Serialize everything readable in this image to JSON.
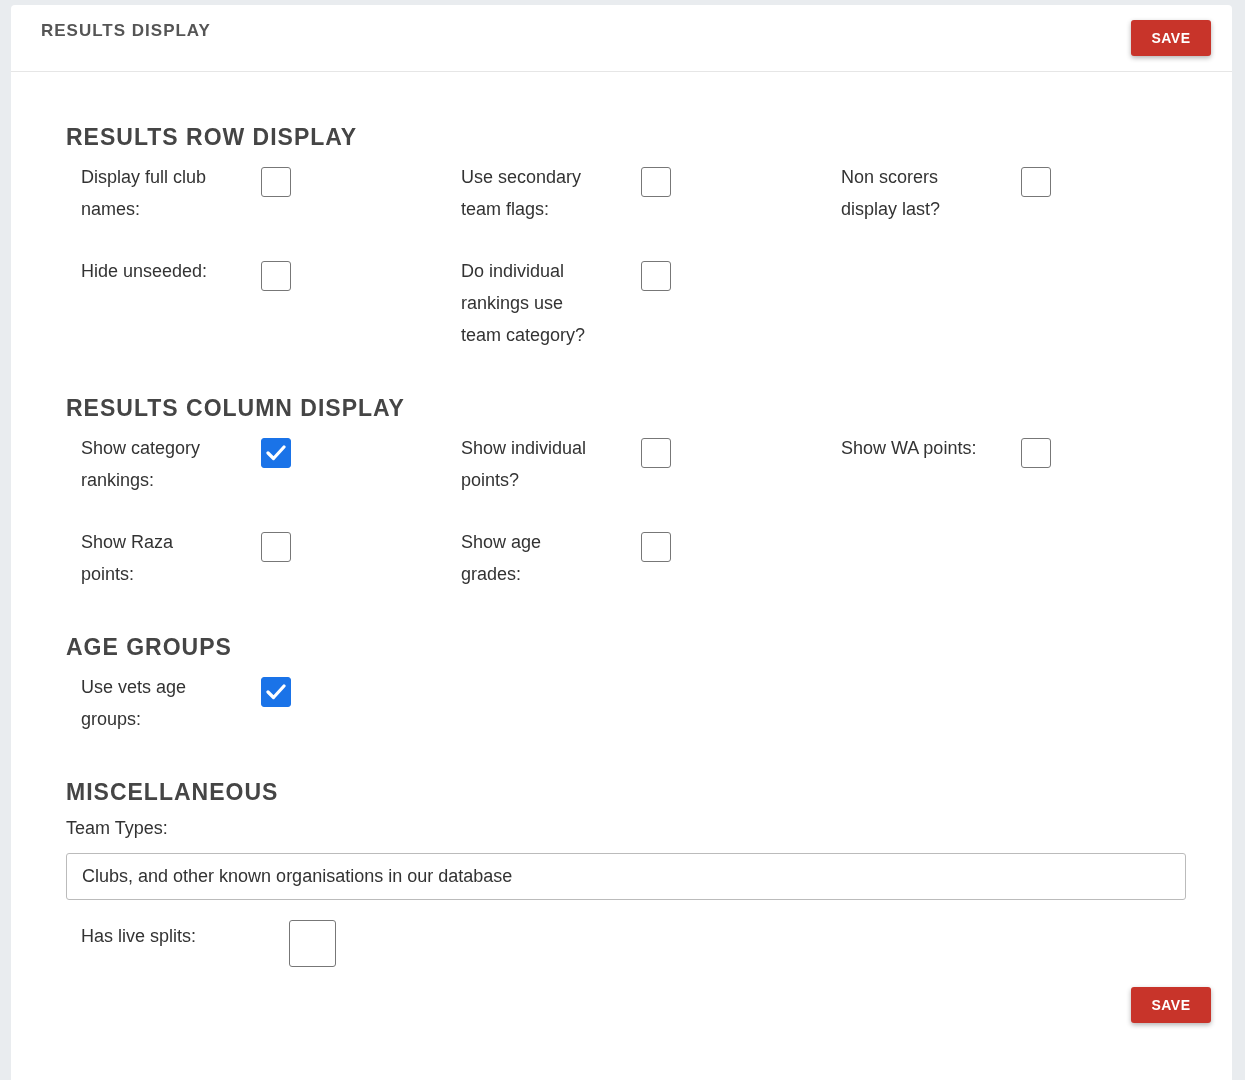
{
  "header": {
    "title": "RESULTS DISPLAY",
    "save_button": "SAVE"
  },
  "sections": [
    {
      "title": "RESULTS ROW DISPLAY",
      "options": [
        {
          "label": "Display full club names:",
          "checked": false
        },
        {
          "label": "Use secondary team flags:",
          "checked": false
        },
        {
          "label": "Non scorers display last?",
          "checked": false
        },
        {
          "label": "Hide unseeded:",
          "checked": false
        },
        {
          "label": "Do individual rankings use team category?",
          "checked": false
        }
      ]
    },
    {
      "title": "RESULTS COLUMN DISPLAY",
      "options": [
        {
          "label": "Show category rankings:",
          "checked": true
        },
        {
          "label": "Show individual points?",
          "checked": false
        },
        {
          "label": "Show WA points:",
          "checked": false
        },
        {
          "label": "Show Raza points:",
          "checked": false
        },
        {
          "label": "Show age grades:",
          "checked": false
        }
      ]
    },
    {
      "title": "AGE GROUPS",
      "options": [
        {
          "label": "Use vets age groups:",
          "checked": true
        }
      ]
    }
  ],
  "miscellaneous": {
    "title": "MISCELLANEOUS",
    "team_types": {
      "label": "Team Types:",
      "value": "Clubs, and other known organisations in our database"
    },
    "live_splits": {
      "label": "Has live splits:",
      "checked": false
    }
  },
  "footer": {
    "save_button": "SAVE"
  }
}
